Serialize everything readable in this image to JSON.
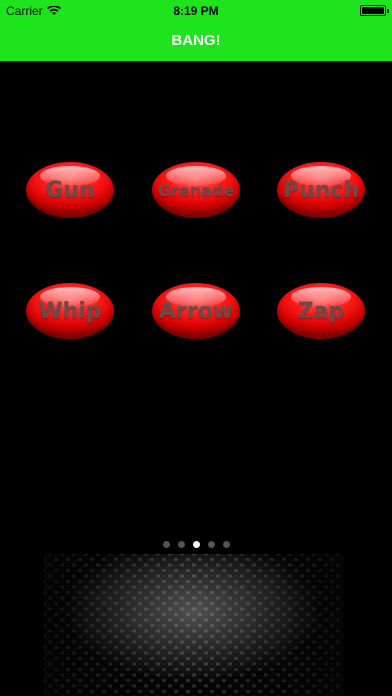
{
  "status_bar": {
    "carrier": "Carrier",
    "time": "8:19 PM"
  },
  "nav": {
    "title": "BANG!"
  },
  "colors": {
    "header": "#1ee41e",
    "button": "#ff1a1a",
    "background": "#000000"
  },
  "buttons": [
    {
      "label": "Gun"
    },
    {
      "label": "Grenade"
    },
    {
      "label": "Punch"
    },
    {
      "label": "Whip"
    },
    {
      "label": "Arrow"
    },
    {
      "label": "Zap"
    }
  ],
  "page_indicator": {
    "pages": 5,
    "current": 3
  }
}
